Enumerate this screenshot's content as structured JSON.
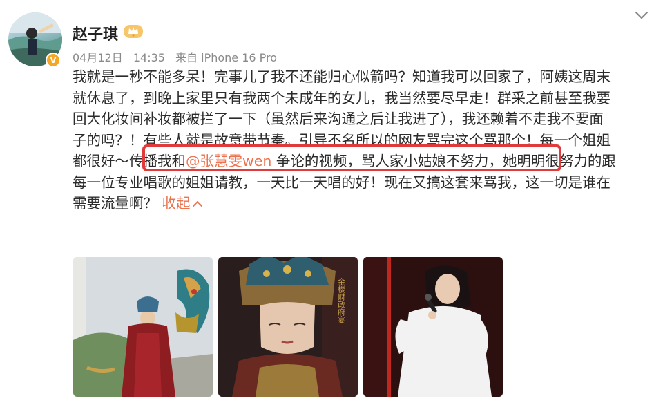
{
  "author": {
    "name": "赵子琪",
    "verified_badge": "V"
  },
  "meta": {
    "date": "04月12日",
    "time": "14:35",
    "source": "来自 iPhone 16 Pro"
  },
  "post": {
    "lines": [
      "我就是一秒不能多呆！完事儿了我不还能归心似箭吗？知道我可以回家了，阿姨这周末",
      "就休息了，到晚上家里只有我两个未成年的女儿，我当然要尽早走！群采之前甚至我要",
      "回大化妆间补妆都被拦了一下（虽然后来沟通之后让我进了），我还赖着不走我不要面",
      "子的吗？！有些人就是故意带节奏。引导不名所以的网友骂完这个骂那个！每一个姐姐"
    ],
    "line5_before": "都很好～传播我和",
    "mention": "@张慧雯wen",
    "line5_after": " 争论的视频，骂人家小姑娘不努力，她明明很努力的跟",
    "line6": "每一位专业唱歌的姐姐请教，一天比一天唱的好！现在又搞这套来骂我，这一切是谁在",
    "line7": "需要流量啊？",
    "collapse_label": "收起",
    "collapse_icon": "chevron-up-icon"
  },
  "icons": {
    "more": "chevron-down-icon",
    "vip": "crown-badge-icon"
  },
  "colors": {
    "link": "#eb7350",
    "highlight": "#e03a3a",
    "verified": "#f5a623"
  },
  "photos": [
    {
      "name": "photo-costume-dragon"
    },
    {
      "name": "photo-poster-headdress"
    },
    {
      "name": "photo-stage-singer"
    }
  ],
  "poster_text": "金楼财政府宴"
}
